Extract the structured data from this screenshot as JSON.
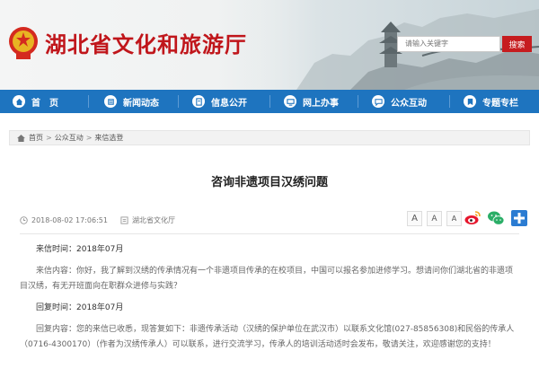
{
  "header": {
    "site_title": "湖北省文化和旅游厅",
    "search_placeholder": "请输入关键字",
    "search_button": "搜索"
  },
  "nav": {
    "items": [
      {
        "label": "首　页",
        "icon": "home-icon"
      },
      {
        "label": "新闻动态",
        "icon": "news-icon"
      },
      {
        "label": "信息公开",
        "icon": "info-icon"
      },
      {
        "label": "网上办事",
        "icon": "service-icon"
      },
      {
        "label": "公众互动",
        "icon": "chat-icon"
      },
      {
        "label": "专题专栏",
        "icon": "topic-icon"
      }
    ]
  },
  "breadcrumb": {
    "items": [
      "首页",
      "公众互动",
      "来信选登"
    ]
  },
  "article": {
    "title": "咨询非遗项目汉绣问题",
    "date": "2018-08-02 17:06:51",
    "source": "湖北省文化厅",
    "font_sizes": [
      "A",
      "A",
      "A"
    ],
    "paragraphs": [
      "来信时间：2018年07月",
      "来信内容：你好，我了解到汉绣的传承情况有一个非遗项目传承的在校项目，中国可以报名参加进修学习。想请问你们湖北省的非遗项目汉绣，有无开班面向在职群众进修与实践？",
      "回复时间：2018年07月",
      "回复内容：您的来信已收悉，现答复如下：非遗传承活动（汉绣的保护单位在武汉市）以联系文化馆(027-85856308)和民俗的传承人（0716-4300170）（作者为汉绣传承人）可以联系，进行交流学习，传承人的培训活动适时会发布，敬请关注，欢迎感谢您的支持！"
    ]
  },
  "colors": {
    "brand_red": "#c0161b",
    "nav_blue": "#1e74bf",
    "search_red": "#c61c1f"
  }
}
